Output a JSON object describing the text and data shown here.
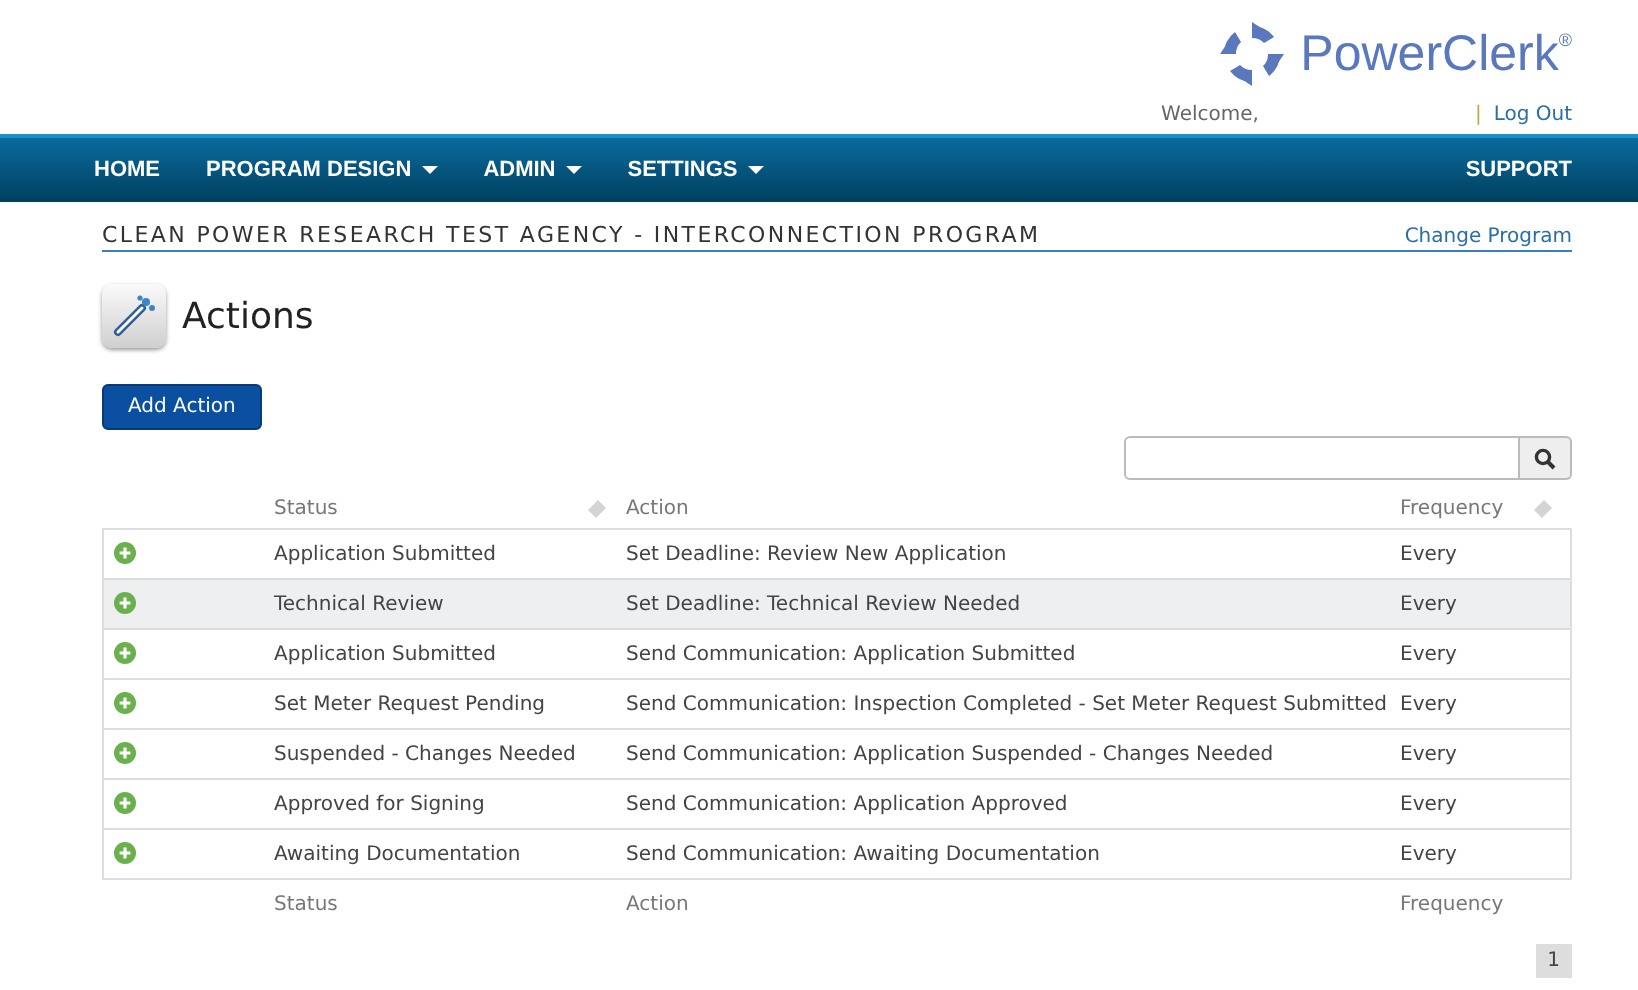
{
  "brand": {
    "name": "PowerClerk",
    "mark": "®"
  },
  "user_bar": {
    "welcome": "Welcome,",
    "separator": "|",
    "logout": "Log Out"
  },
  "nav": {
    "items": [
      {
        "label": "HOME",
        "dropdown": false
      },
      {
        "label": "PROGRAM DESIGN",
        "dropdown": true
      },
      {
        "label": "ADMIN",
        "dropdown": true
      },
      {
        "label": "SETTINGS",
        "dropdown": true
      }
    ],
    "right": "SUPPORT"
  },
  "program": {
    "title": "CLEAN POWER RESEARCH TEST AGENCY - INTERCONNECTION PROGRAM",
    "change_link": "Change Program"
  },
  "page_title": "Actions",
  "add_button": "Add Action",
  "search_button": {
    "kind": "search"
  },
  "table": {
    "columns": [
      {
        "label": "Status",
        "sortable": true
      },
      {
        "label": "Action",
        "sortable": false
      },
      {
        "label": "Frequency",
        "sortable": true
      }
    ],
    "rows": [
      {
        "status": "Application Submitted",
        "action": "Set Deadline: Review New Application",
        "frequency": "Every",
        "selected": false
      },
      {
        "status": "Technical Review",
        "action": "Set Deadline: Technical Review Needed",
        "frequency": "Every",
        "selected": true
      },
      {
        "status": "Application Submitted",
        "action": "Send Communication: Application Submitted",
        "frequency": "Every",
        "selected": false
      },
      {
        "status": "Set Meter Request Pending",
        "action": "Send Communication: Inspection Completed - Set Meter Request Submitted",
        "frequency": "Every",
        "selected": false
      },
      {
        "status": "Suspended - Changes Needed",
        "action": "Send Communication: Application Suspended - Changes Needed",
        "frequency": "Every",
        "selected": false
      },
      {
        "status": "Approved for Signing",
        "action": "Send Communication: Application Approved",
        "frequency": "Every",
        "selected": false
      },
      {
        "status": "Awaiting Documentation",
        "action": "Send Communication: Awaiting Documentation",
        "frequency": "Every",
        "selected": false
      }
    ],
    "footer": [
      "Status",
      "Action",
      "Frequency"
    ]
  },
  "pagination": [
    {
      "label": "1",
      "selected": true
    }
  ]
}
